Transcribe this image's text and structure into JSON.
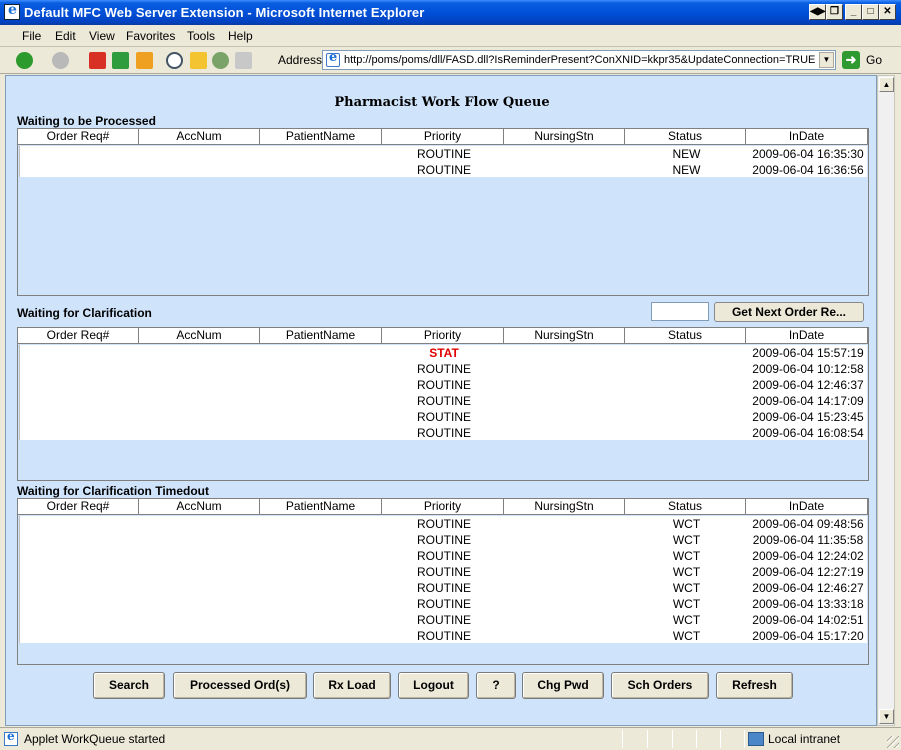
{
  "window": {
    "title": "Default MFC Web Server Extension - Microsoft Internet Explorer",
    "controls": [
      "⬌",
      "8",
      "_",
      "□",
      "✕"
    ]
  },
  "menu": {
    "items": [
      "File",
      "Edit",
      "View",
      "Favorites",
      "Tools",
      "Help"
    ]
  },
  "toolbar": {
    "address_label": "Address",
    "url": "http://poms/poms/dll/FASD.dll?IsReminderPresent?ConXNID=kkpr35&UpdateConnection=TRUE",
    "go_label": "Go",
    "icons": [
      "back-icon",
      "forward-icon",
      "stop-icon",
      "refresh-icon",
      "home-icon",
      "search-icon",
      "favorites-icon",
      "media-icon",
      "print-icon"
    ]
  },
  "page": {
    "heading": "Pharmacist Work Flow Queue",
    "columns": [
      "Order Req#",
      "AccNum",
      "PatientName",
      "Priority",
      "NursingStn",
      "Status",
      "InDate"
    ],
    "sections": [
      {
        "label": "Waiting to be Processed",
        "rows": [
          {
            "order": "",
            "acc": "",
            "patient": "",
            "priority": "ROUTINE",
            "nursing": "",
            "status": "NEW",
            "indate": "2009-06-04 16:35:30"
          },
          {
            "order": "",
            "acc": "",
            "patient": "",
            "priority": "ROUTINE",
            "nursing": "",
            "status": "NEW",
            "indate": "2009-06-04 16:36:56"
          }
        ]
      },
      {
        "label": "Waiting for Clarification",
        "next_button": "Get Next Order Re...",
        "rows": [
          {
            "order": "",
            "acc": "",
            "patient": "",
            "priority": "STAT",
            "nursing": "",
            "status": "",
            "indate": "2009-06-04 15:57:19"
          },
          {
            "order": "",
            "acc": "",
            "patient": "",
            "priority": "ROUTINE",
            "nursing": "",
            "status": "",
            "indate": "2009-06-04 10:12:58"
          },
          {
            "order": "",
            "acc": "",
            "patient": "",
            "priority": "ROUTINE",
            "nursing": "",
            "status": "",
            "indate": "2009-06-04 12:46:37"
          },
          {
            "order": "",
            "acc": "",
            "patient": "",
            "priority": "ROUTINE",
            "nursing": "",
            "status": "",
            "indate": "2009-06-04 14:17:09"
          },
          {
            "order": "",
            "acc": "",
            "patient": "",
            "priority": "ROUTINE",
            "nursing": "",
            "status": "",
            "indate": "2009-06-04 15:23:45"
          },
          {
            "order": "",
            "acc": "",
            "patient": "",
            "priority": "ROUTINE",
            "nursing": "",
            "status": "",
            "indate": "2009-06-04 16:08:54"
          }
        ]
      },
      {
        "label": "Waiting for Clarification Timedout",
        "rows": [
          {
            "order": "",
            "acc": "",
            "patient": "",
            "priority": "ROUTINE",
            "nursing": "",
            "status": "WCT",
            "indate": "2009-06-04 09:48:56"
          },
          {
            "order": "",
            "acc": "",
            "patient": "",
            "priority": "ROUTINE",
            "nursing": "",
            "status": "WCT",
            "indate": "2009-06-04 11:35:58"
          },
          {
            "order": "",
            "acc": "",
            "patient": "",
            "priority": "ROUTINE",
            "nursing": "",
            "status": "WCT",
            "indate": "2009-06-04 12:24:02"
          },
          {
            "order": "",
            "acc": "",
            "patient": "",
            "priority": "ROUTINE",
            "nursing": "",
            "status": "WCT",
            "indate": "2009-06-04 12:27:19"
          },
          {
            "order": "",
            "acc": "",
            "patient": "",
            "priority": "ROUTINE",
            "nursing": "",
            "status": "WCT",
            "indate": "2009-06-04 12:46:27"
          },
          {
            "order": "",
            "acc": "",
            "patient": "",
            "priority": "ROUTINE",
            "nursing": "",
            "status": "WCT",
            "indate": "2009-06-04 13:33:18"
          },
          {
            "order": "",
            "acc": "",
            "patient": "",
            "priority": "ROUTINE",
            "nursing": "",
            "status": "WCT",
            "indate": "2009-06-04 14:02:51"
          },
          {
            "order": "",
            "acc": "",
            "patient": "",
            "priority": "ROUTINE",
            "nursing": "",
            "status": "WCT",
            "indate": "2009-06-04 15:17:20"
          }
        ]
      }
    ],
    "buttons": [
      "Search",
      "Processed Ord(s)",
      "Rx Load",
      "Logout",
      "?",
      "Chg Pwd",
      "Sch Orders",
      "Refresh"
    ]
  },
  "status": {
    "text": "Applet WorkQueue started",
    "zone": "Local intranet"
  },
  "colors": {
    "content_bg": "#cfe4fb",
    "stat": "#e00000",
    "titlebar": "#0050d8"
  }
}
